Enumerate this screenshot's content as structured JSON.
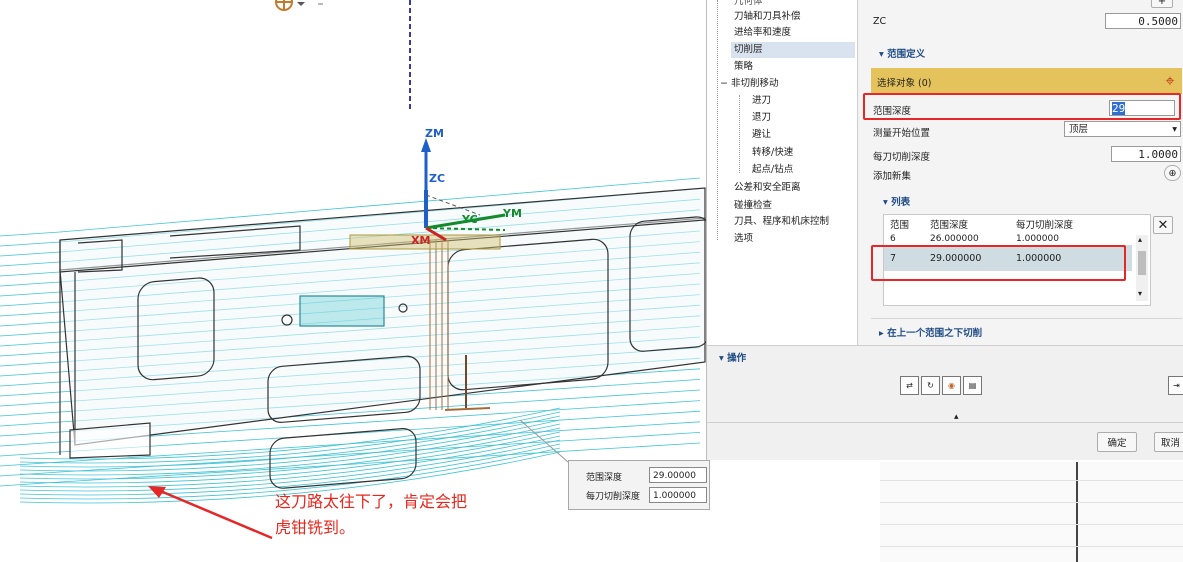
{
  "viewport": {
    "axes": {
      "zm": "ZM",
      "zc": "ZC",
      "yc": "YC",
      "ym": "YM",
      "xm": "XM"
    }
  },
  "tree": {
    "items": [
      "几何体",
      "刀轴和刀具补偿",
      "进给率和速度",
      "切削层",
      "策略",
      "非切削移动",
      "进刀",
      "退刀",
      "避让",
      "转移/快速",
      "起点/钻点",
      "公差和安全距离",
      "碰撞检查",
      "刀具、程序和机床控制",
      "选项"
    ],
    "selected_index": 3
  },
  "props": {
    "zc_label": "ZC",
    "zc_value": "0.5000",
    "range_section": "范围定义",
    "select_object": "选择对象 (0)",
    "range_depth_label": "范围深度",
    "range_depth_value": "29",
    "measure_start_label": "测量开始位置",
    "measure_start_value": "顶层",
    "depth_per_cut_label": "每刀切削深度",
    "depth_per_cut_value": "1.0000",
    "add_set_label": "添加新集",
    "list_section": "列表",
    "list_columns": [
      "范围",
      "范围深度",
      "每刀切削深度"
    ],
    "list_rows": [
      [
        "6",
        "26.000000",
        "1.000000"
      ],
      [
        "7",
        "29.000000",
        "1.000000"
      ]
    ],
    "cut_below_section": "在上一个范围之下切削"
  },
  "ops": {
    "title": "操作"
  },
  "footer": {
    "ok_label": "确定",
    "cancel_label": "取消"
  },
  "tooltip": {
    "range_depth_label": "范围深度",
    "range_depth_value": "29.00000",
    "depth_per_cut_label": "每刀切削深度",
    "depth_per_cut_value": "1.000000"
  },
  "annotation": {
    "line1": "这刀路太往下了，肯定会把",
    "line2": "虎钳铣到。"
  },
  "colors": {
    "toolpath": "#3fc4d6",
    "highlight_red": "#e52727",
    "section_blue": "#1e4b86",
    "select_bar": "#e4c35c"
  }
}
